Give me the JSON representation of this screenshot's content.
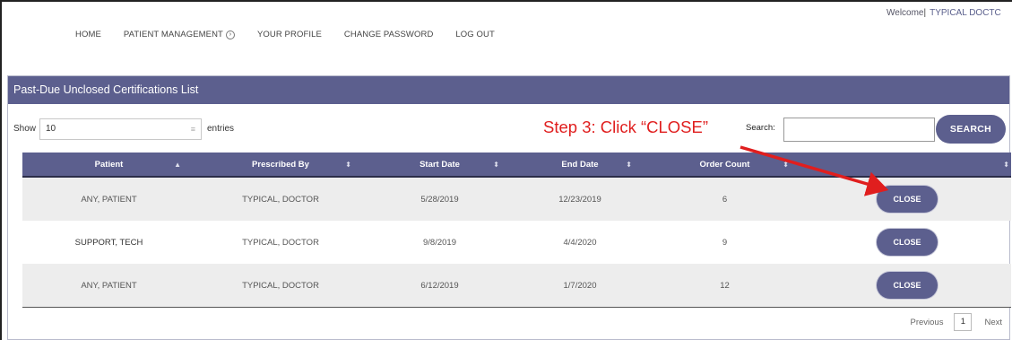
{
  "nav": {
    "items": [
      "HOME",
      "PATIENT MANAGEMENT",
      "YOUR PROFILE",
      "CHANGE PASSWORD",
      "LOG OUT"
    ],
    "expand_icon": "circle-chevron-icon"
  },
  "welcome": {
    "label": "Welcome",
    "user": "TYPICAL DOCTC"
  },
  "panel": {
    "title": "Past-Due Unclosed Certifications List"
  },
  "controls": {
    "show_label": "Show",
    "entries_value": "10",
    "entries_label": "entries",
    "search_label": "Search:",
    "search_value": "",
    "search_button": "SEARCH"
  },
  "annotation": {
    "text": "Step 3: Click “CLOSE”",
    "color": "#e01e1e"
  },
  "table": {
    "columns": [
      "Patient",
      "Prescribed By",
      "Start Date",
      "End Date",
      "Order Count",
      ""
    ],
    "rows": [
      [
        "ANY, PATIENT",
        "TYPICAL, DOCTOR",
        "5/28/2019",
        "12/23/2019",
        "6"
      ],
      [
        "SUPPORT, TECH",
        "TYPICAL, DOCTOR",
        "9/8/2019",
        "4/4/2020",
        "9"
      ],
      [
        "ANY, PATIENT",
        "TYPICAL, DOCTOR",
        "6/12/2019",
        "1/7/2020",
        "12"
      ]
    ],
    "action_label": "CLOSE"
  },
  "pager": {
    "previous": "Previous",
    "page": "1",
    "next": "Next"
  },
  "colors": {
    "accent": "#5c5f8e",
    "annotation": "#e01e1e"
  }
}
